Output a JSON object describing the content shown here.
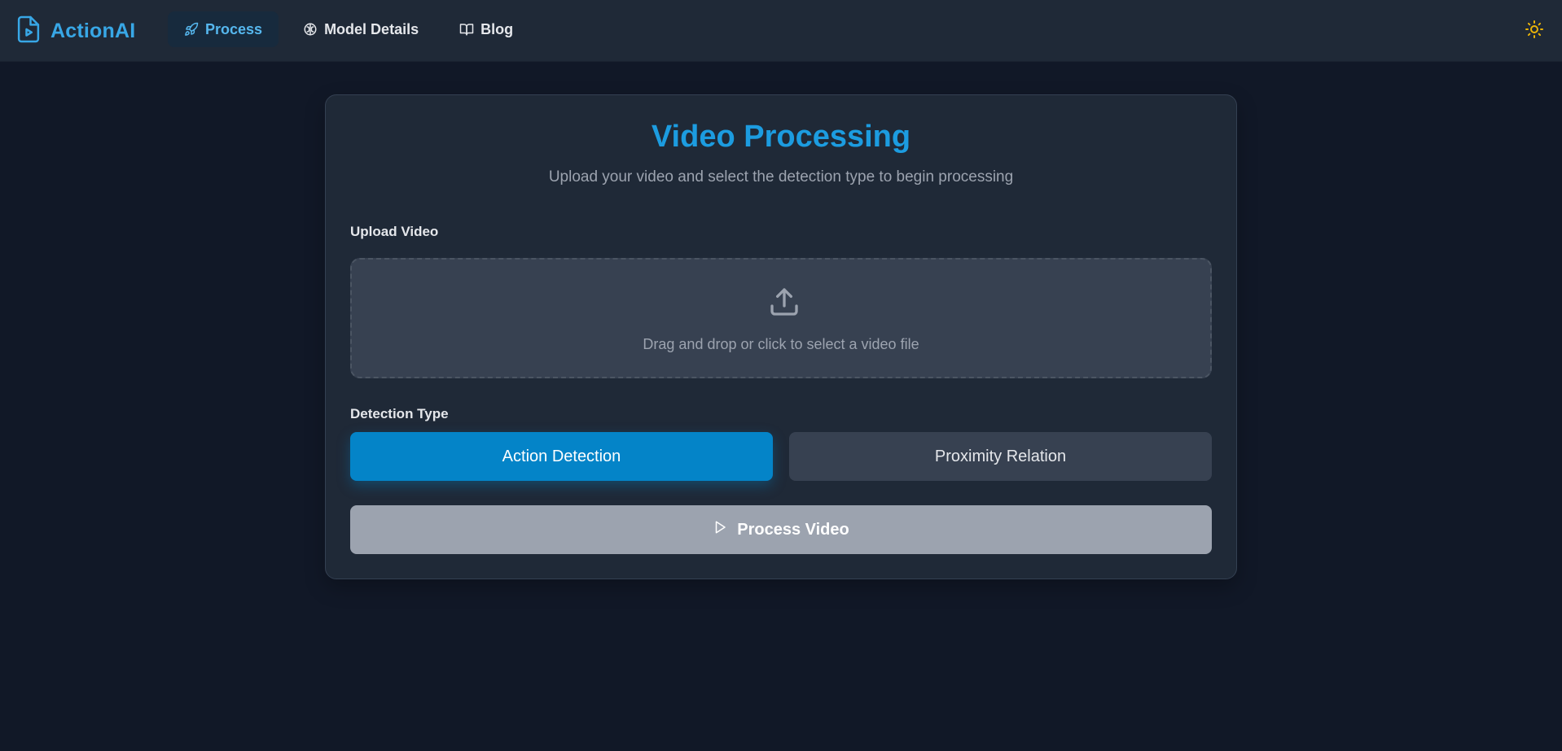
{
  "brand": {
    "name": "ActionAI",
    "icon": "file-video-icon"
  },
  "nav": {
    "items": [
      {
        "label": "Process",
        "icon": "rocket-icon",
        "active": true
      },
      {
        "label": "Model Details",
        "icon": "brain-icon",
        "active": false
      },
      {
        "label": "Blog",
        "icon": "book-open-icon",
        "active": false
      }
    ]
  },
  "theme_toggle": {
    "icon": "sun-icon",
    "color": "#eab308"
  },
  "card": {
    "title": "Video Processing",
    "subtitle": "Upload your video and select the detection type to begin processing"
  },
  "upload": {
    "label": "Upload Video",
    "dropzone_text": "Drag and drop or click to select a video file",
    "icon": "upload-icon"
  },
  "detection": {
    "label": "Detection Type",
    "options": [
      {
        "label": "Action Detection",
        "selected": true
      },
      {
        "label": "Proximity Relation",
        "selected": false
      }
    ]
  },
  "process_button": {
    "label": "Process Video",
    "icon": "play-icon"
  },
  "colors": {
    "accent": "#1c9ce0",
    "primary_button": "#0484c8",
    "background": "#111827",
    "surface": "#1f2937"
  }
}
